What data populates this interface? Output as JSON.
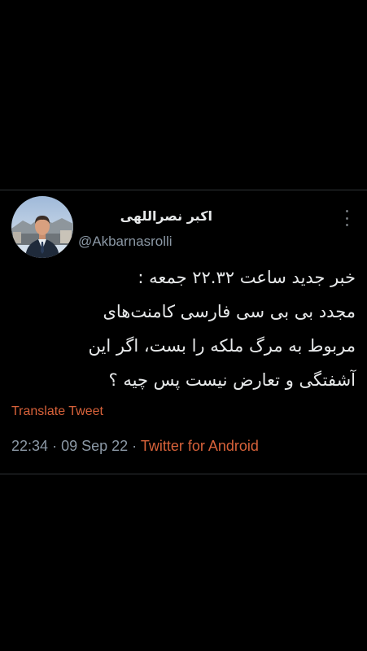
{
  "tweet": {
    "author": {
      "display_name": "اکبر نصراللهی",
      "handle": "@Akbarnasrolli"
    },
    "body_lines": [
      "خبر جدید ساعت ۲۲.۳۲ جمعه :",
      "مجدد بی بی سی فارسی کامنت‌های",
      "مربوط  به مرگ ملکه را بست، اگر این",
      "آشفتگی  و تعارض نیست پس چیه ؟"
    ],
    "translate_label": "Translate Tweet",
    "time": "22:34",
    "date": "09 Sep 22",
    "separator": "·",
    "source": "Twitter for Android"
  },
  "icons": {
    "more": "more-options-icon",
    "avatar": "profile-photo"
  },
  "colors": {
    "background": "#000000",
    "text": "#e7e9ea",
    "muted": "#8b98a5",
    "accent": "#d8623a",
    "divider": "#2f3336"
  }
}
